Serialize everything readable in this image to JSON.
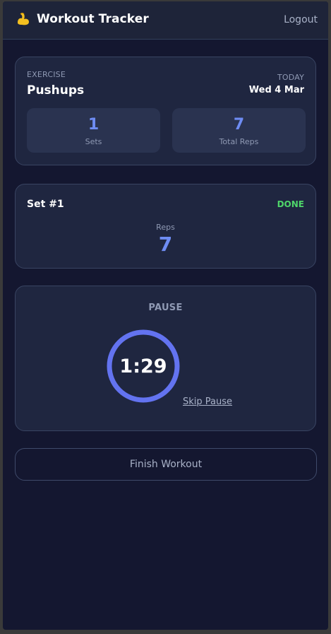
{
  "header": {
    "icon": "flexed-biceps-icon",
    "title": "Workout Tracker",
    "logout_label": "Logout"
  },
  "exercise": {
    "label": "EXERCISE",
    "name": "Pushups",
    "today_label": "TODAY",
    "date": "Wed 4 Mar",
    "stats": [
      {
        "value": "1",
        "label": "Sets"
      },
      {
        "value": "7",
        "label": "Total Reps"
      }
    ]
  },
  "set": {
    "title": "Set #1",
    "status": "DONE",
    "reps_label": "Reps",
    "reps_value": "7"
  },
  "pause": {
    "title": "PAUSE",
    "timer": "1:29",
    "skip_label": "Skip Pause"
  },
  "finish_label": "Finish Workout",
  "colors": {
    "accent": "#6e8cf3",
    "success": "#4fd66a",
    "background": "#141730",
    "card": "#1f2640"
  }
}
